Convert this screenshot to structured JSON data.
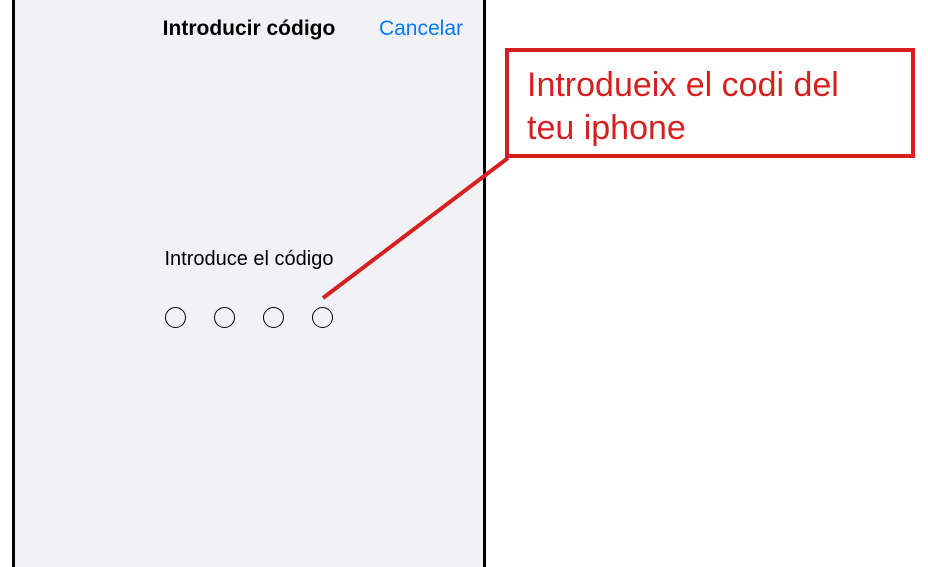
{
  "sheet": {
    "title": "Introducir código",
    "cancel": "Cancelar"
  },
  "passcode": {
    "prompt": "Introduce el código",
    "length": 4
  },
  "annotation": {
    "text": "Introdueix el codi del teu iphone",
    "color": "#d61f1f"
  }
}
